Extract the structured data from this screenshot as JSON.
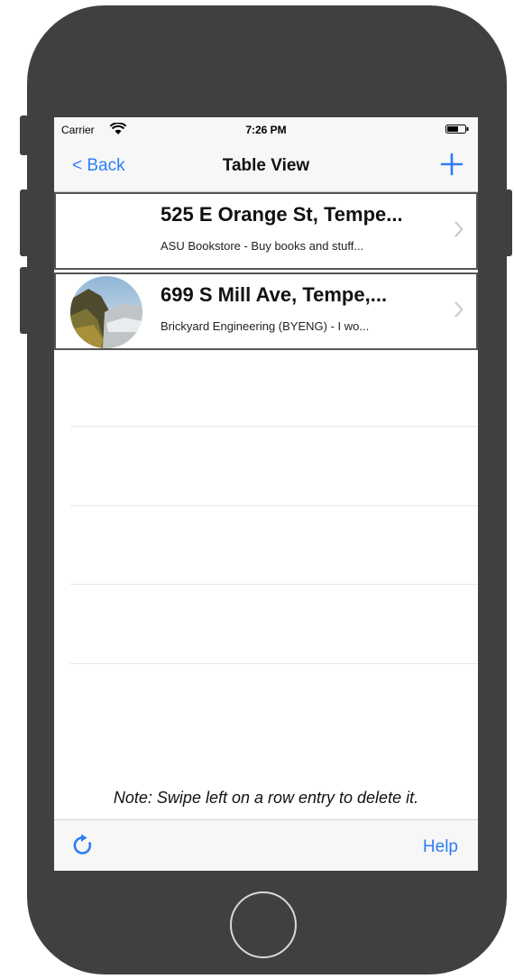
{
  "status_bar": {
    "carrier": "Carrier",
    "time": "7:26 PM"
  },
  "nav_bar": {
    "back_label": "< Back",
    "title": "Table View",
    "add_icon": "plus-icon"
  },
  "rows": [
    {
      "title": "525 E Orange St, Tempe...",
      "subtitle": "ASU Bookstore - Buy books and stuff...",
      "has_image": false
    },
    {
      "title": "699 S Mill Ave, Tempe,...",
      "subtitle": "Brickyard Engineering (BYENG) - I wo...",
      "has_image": true,
      "image": "landscape-photo"
    }
  ],
  "note": "Note: Swipe left on a row entry to delete it.",
  "toolbar": {
    "refresh_icon": "refresh-icon",
    "help_label": "Help"
  },
  "colors": {
    "accent": "#2d7df6",
    "phone_body": "#404040",
    "row_border": "#555555"
  }
}
